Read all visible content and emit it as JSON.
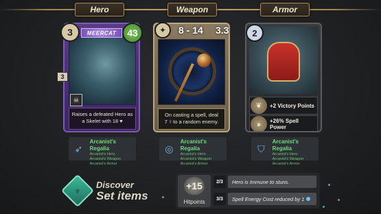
{
  "slots": {
    "hero": "Hero",
    "weapon": "Weapon",
    "armor": "Armor"
  },
  "hero_card": {
    "name": "MEERCAT",
    "cost": "3",
    "health": "43",
    "armor": "3",
    "description": "Raises a defeated Hero as a Skelet with 18",
    "skill_icon": "skull-icon"
  },
  "weapon_card": {
    "damage": "8 - 14",
    "speed": "3.3",
    "description_pre": "On casting a spell, deal",
    "description_num": "7",
    "description_post": "to a random enemy.",
    "type_icon": "staff-icon"
  },
  "armor_card": {
    "cost": "2",
    "stat1": "+2 Victory Points",
    "stat2_line1": "+26% Spell",
    "stat2_line2": "Power"
  },
  "sets": {
    "hero": {
      "title": "Arcanist's Regalia",
      "pieces": [
        "Arcanist's Hero",
        "Arcanist's Weapon",
        "Arcanist's Armor"
      ]
    },
    "weapon": {
      "title": "Arcanist's Regalia",
      "pieces": [
        "Arcanist's Hero",
        "Arcanist's Weapon",
        "Arcanist's Armor"
      ]
    },
    "armor": {
      "title": "Arcanist's Regalia",
      "pieces": [
        "Arcanist's Hero",
        "Arcanist's Weapon",
        "Arcanist's Armor"
      ]
    }
  },
  "discover": {
    "line1": "Discover",
    "line2": "Set items"
  },
  "bonus": {
    "hp_value": "+15",
    "hp_label": "Hitpoints",
    "rows": [
      {
        "fraction": "2/3",
        "text": "Hero is Immune to stuns."
      },
      {
        "fraction": "3/3",
        "text": "Spell Energy Cost reduced by 1"
      }
    ]
  },
  "colors": {
    "accent_gold": "#b08a52",
    "set_green": "#6fdc7e",
    "hero_purple": "#5b3b88"
  }
}
